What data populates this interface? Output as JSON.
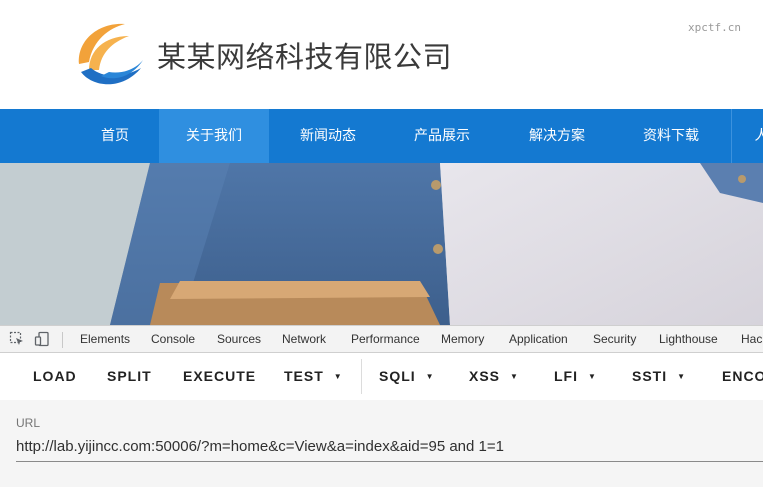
{
  "site": {
    "company_name": "某某网络科技有限公司",
    "watermark": "xpctf.cn"
  },
  "nav": {
    "items": [
      {
        "label": "首页"
      },
      {
        "label": "关于我们"
      },
      {
        "label": "新闻动态"
      },
      {
        "label": "产品展示"
      },
      {
        "label": "解决方案"
      },
      {
        "label": "资料下载"
      },
      {
        "label": "人"
      }
    ],
    "active_index": 1
  },
  "devtools": {
    "tabs": [
      "Elements",
      "Console",
      "Sources",
      "Network",
      "Performance",
      "Memory",
      "Application",
      "Security",
      "Lighthouse",
      "Hack"
    ]
  },
  "hackbar": {
    "buttons": [
      {
        "label": "LOAD",
        "dropdown": false
      },
      {
        "label": "SPLIT",
        "dropdown": false
      },
      {
        "label": "EXECUTE",
        "dropdown": false
      },
      {
        "label": "TEST",
        "dropdown": true
      },
      {
        "label": "SQLI",
        "dropdown": true
      },
      {
        "label": "XSS",
        "dropdown": true
      },
      {
        "label": "LFI",
        "dropdown": true
      },
      {
        "label": "SSTI",
        "dropdown": true
      },
      {
        "label": "ENCO",
        "dropdown": false
      }
    ],
    "url_label": "URL",
    "url_value": "http://lab.yijincc.com:50006/?m=home&c=View&a=index&aid=95 and 1=1"
  },
  "colors": {
    "nav_bg": "#1479d1",
    "nav_active_bg": "#2f8fe0",
    "logo_orange": "#f2a23a",
    "logo_blue": "#1f6fc4"
  }
}
